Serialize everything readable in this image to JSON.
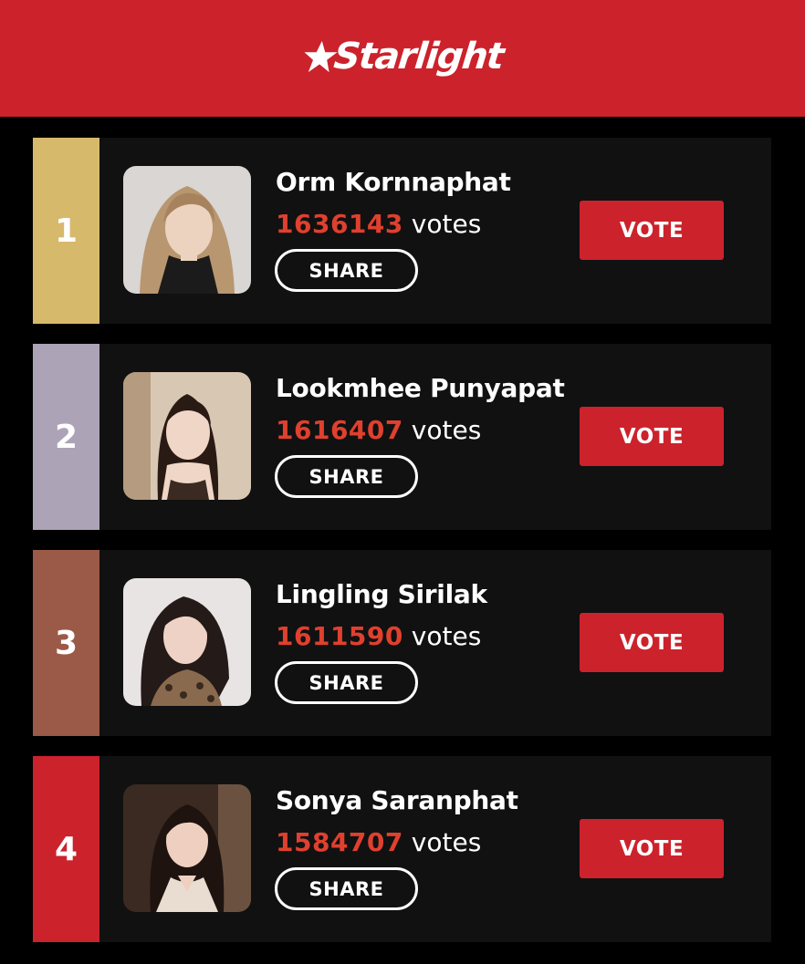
{
  "header": {
    "logo_text": "Starlight",
    "background": "#cc222c"
  },
  "entries": [
    {
      "rank": "1",
      "name": "Orm Kornnaphat",
      "vote_count": "1636143",
      "votes_label": "votes",
      "share_label": "SHARE",
      "vote_label": "VOTE",
      "rank_color": "#d7b96b"
    },
    {
      "rank": "2",
      "name": "Lookmhee Punyapat",
      "vote_count": "1616407",
      "votes_label": "votes",
      "share_label": "SHARE",
      "vote_label": "VOTE",
      "rank_color": "#aca3b7"
    },
    {
      "rank": "3",
      "name": "Lingling Sirilak",
      "vote_count": "1611590",
      "votes_label": "votes",
      "share_label": "SHARE",
      "vote_label": "VOTE",
      "rank_color": "#9b5a48"
    },
    {
      "rank": "4",
      "name": "Sonya Saranphat",
      "vote_count": "1584707",
      "votes_label": "votes",
      "share_label": "SHARE",
      "vote_label": "VOTE",
      "rank_color": "#cc222c"
    }
  ],
  "colors": {
    "accent": "#cc222c",
    "vote_count": "#e0402e",
    "card_bg": "#111111"
  }
}
